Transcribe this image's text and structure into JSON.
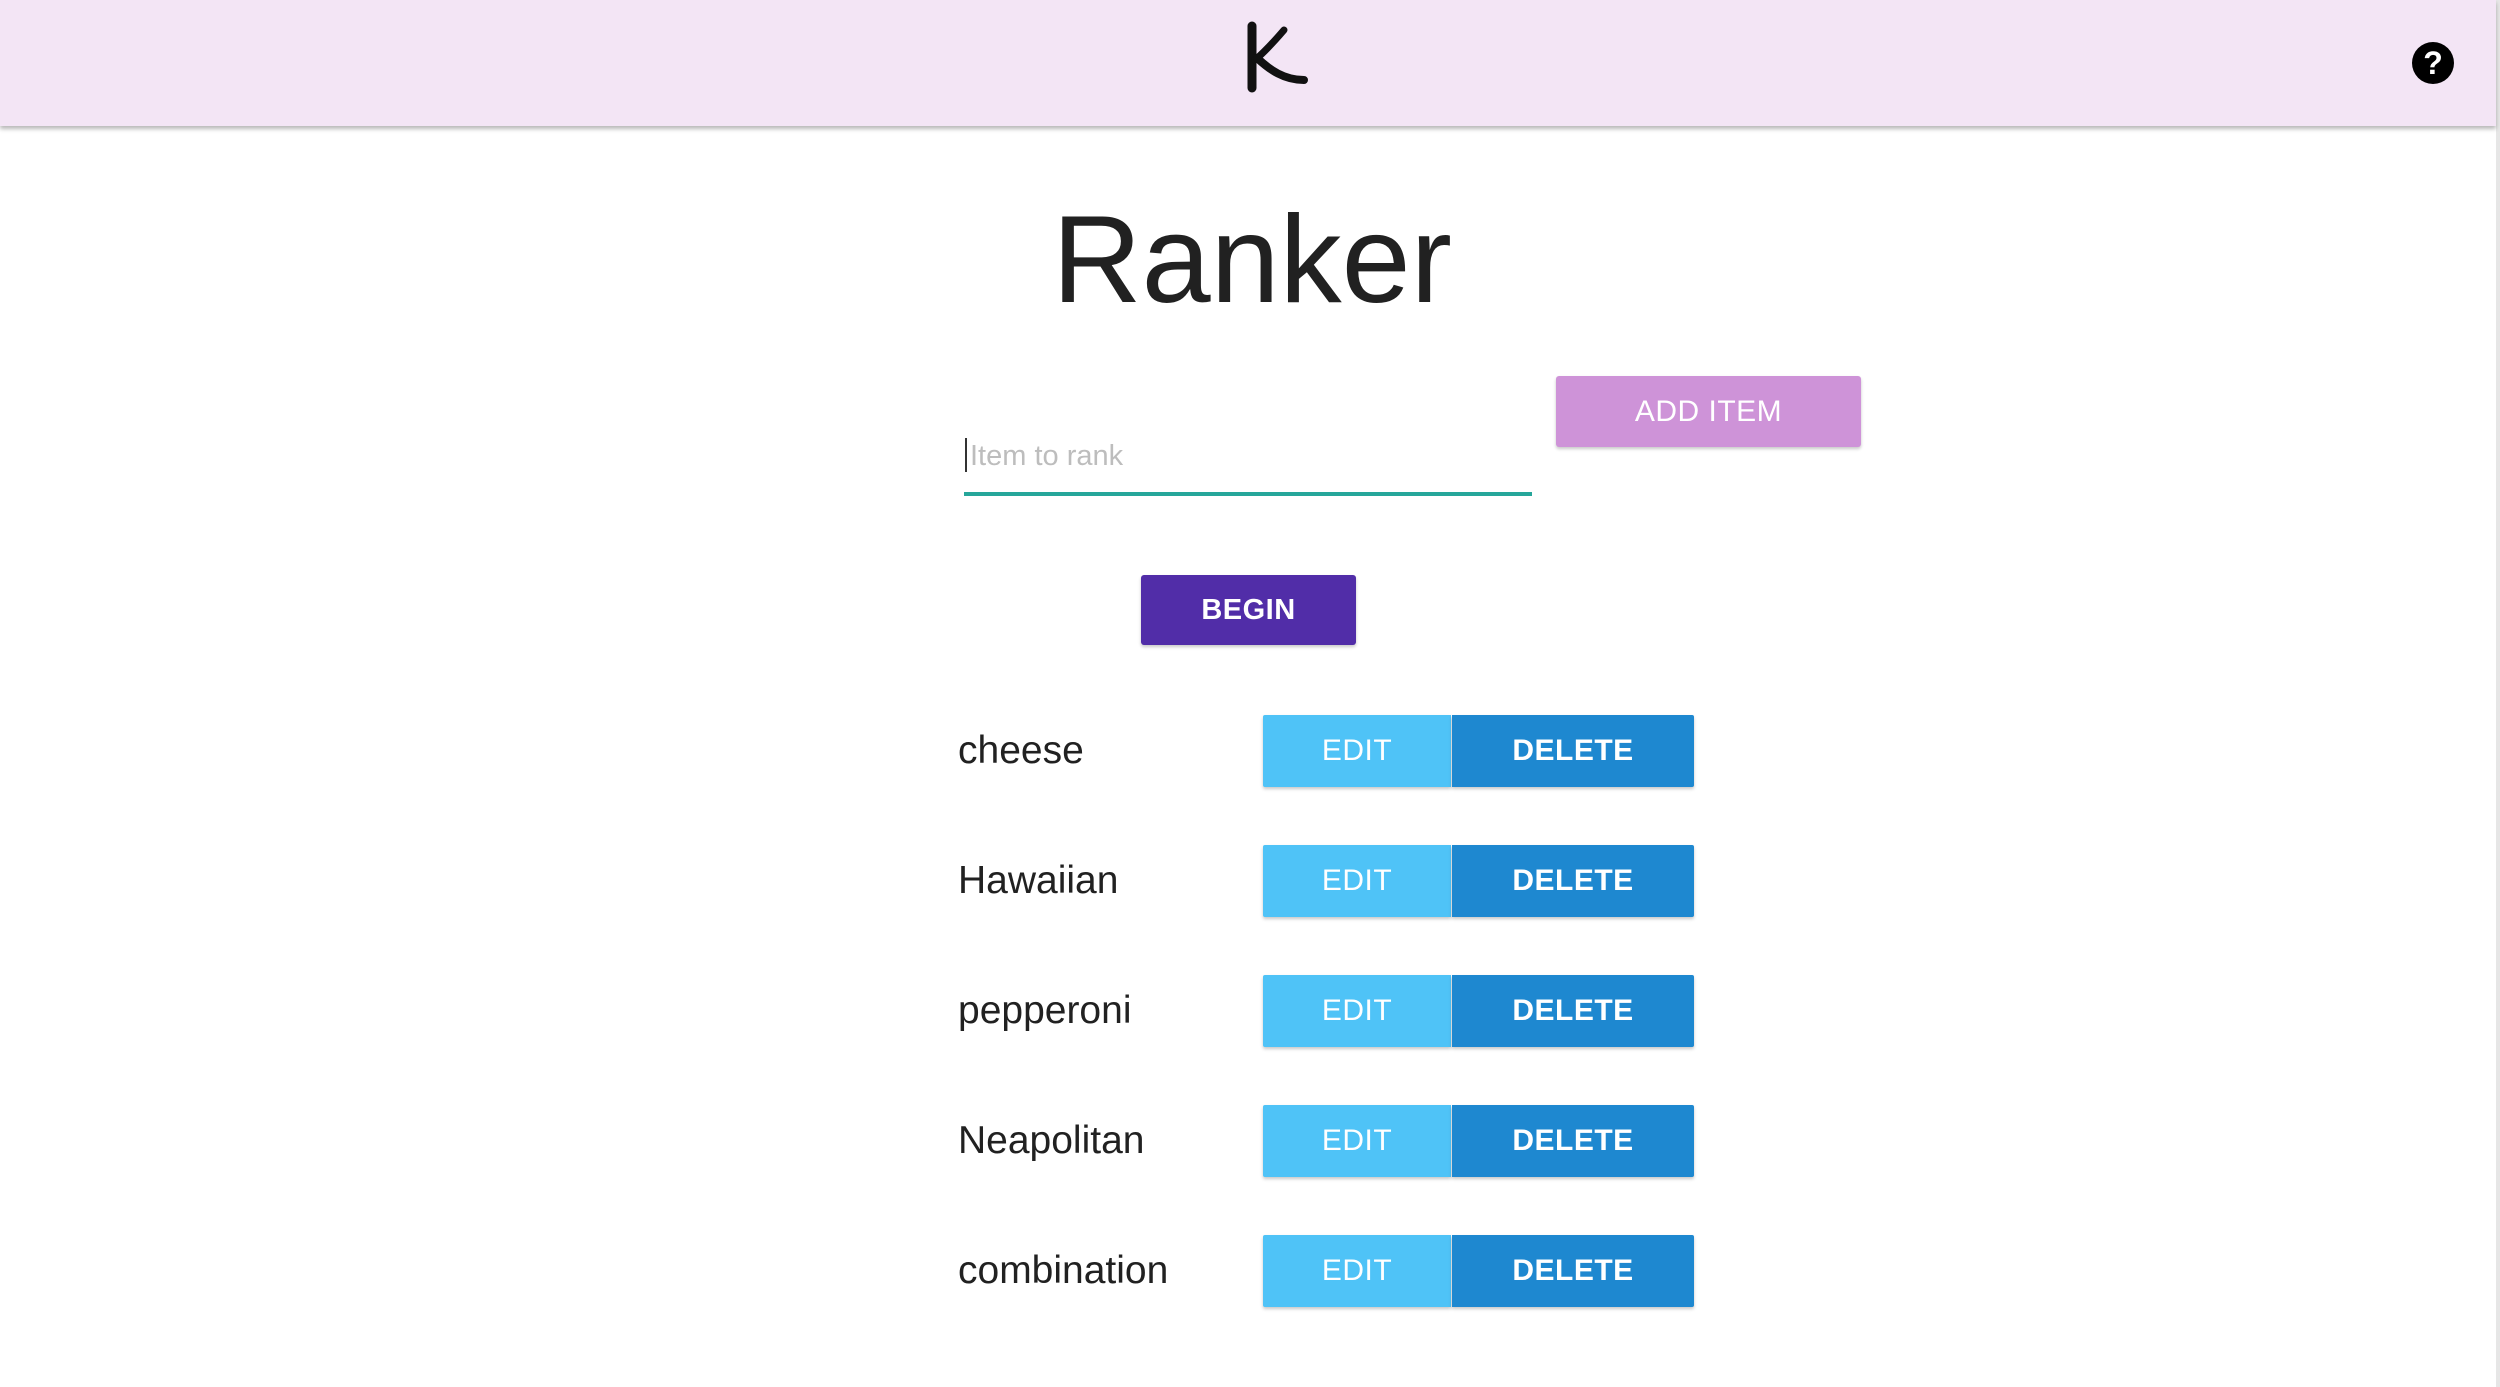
{
  "header": {
    "logo_icon": "k-logo-icon",
    "help_label": "?",
    "help_icon": "help-circle-icon",
    "bar_color": "#f3e5f5"
  },
  "main": {
    "title": "Ranker",
    "input": {
      "value": "",
      "placeholder": "Item to rank",
      "underline_color": "#26a69a"
    },
    "add_button_label": "ADD ITEM",
    "begin_button_label": "BEGIN",
    "items": [
      {
        "name": "cheese",
        "edit_label": "EDIT",
        "delete_label": "DELETE"
      },
      {
        "name": "Hawaiian",
        "edit_label": "EDIT",
        "delete_label": "DELETE"
      },
      {
        "name": "pepperoni",
        "edit_label": "EDIT",
        "delete_label": "DELETE"
      },
      {
        "name": "Neapolitan",
        "edit_label": "EDIT",
        "delete_label": "DELETE"
      },
      {
        "name": "combination",
        "edit_label": "EDIT",
        "delete_label": "DELETE"
      }
    ]
  },
  "colors": {
    "add_button": "#ce93d8",
    "begin_button": "#512da8",
    "edit_button": "#4fc3f7",
    "delete_button": "#1e88d0"
  }
}
